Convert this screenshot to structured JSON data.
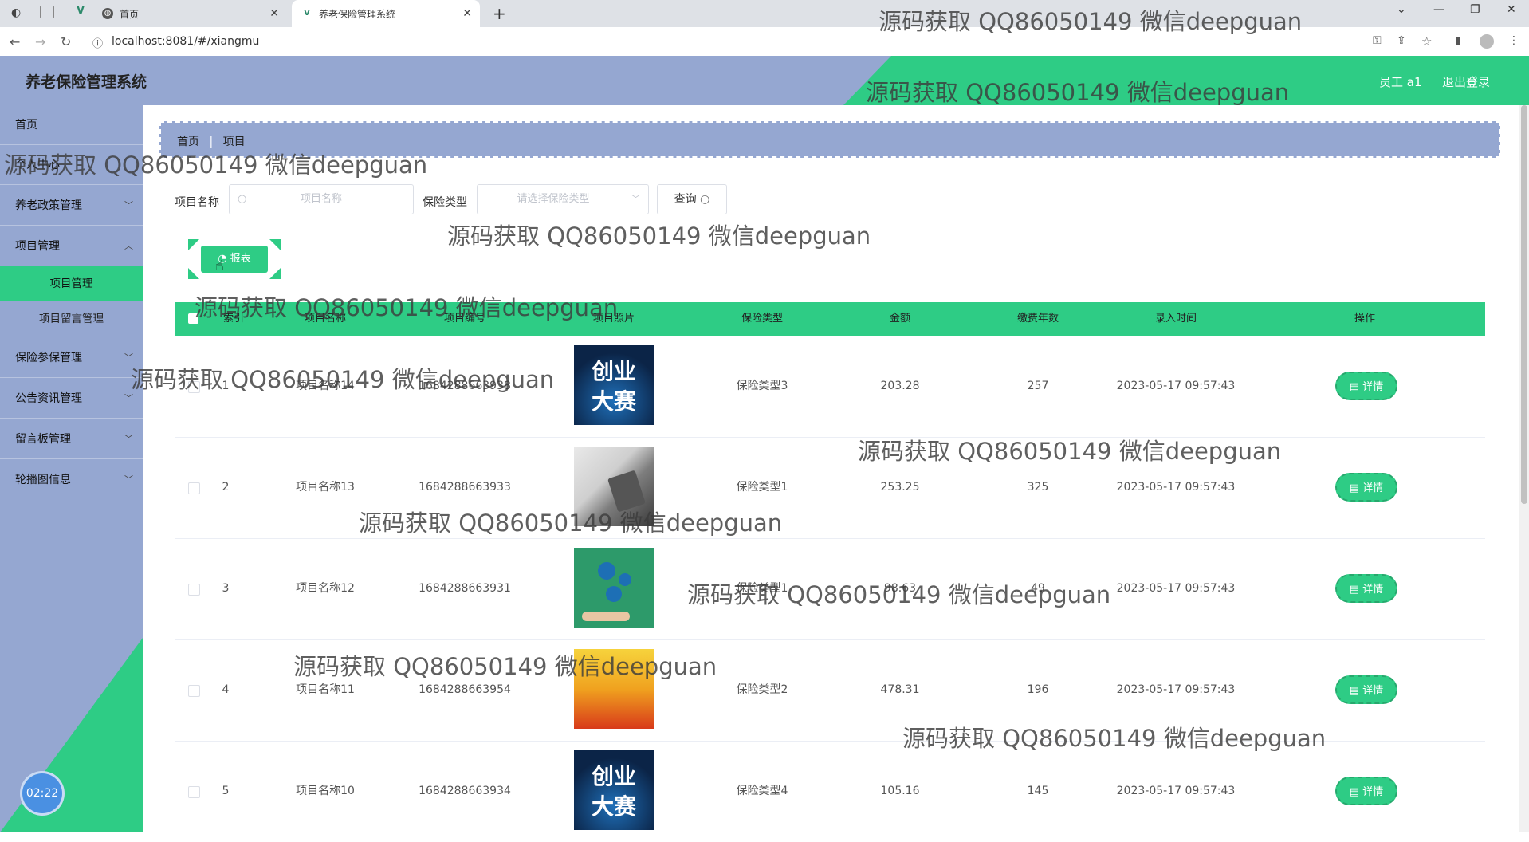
{
  "browser": {
    "tabs": [
      {
        "label": "首页"
      },
      {
        "label": "养老保险管理系统"
      }
    ],
    "url": "localhost:8081/#/xiangmu"
  },
  "app": {
    "title": "养老保险管理系统",
    "user_label": "员工 a1",
    "logout_label": "退出登录"
  },
  "sidebar": {
    "items": [
      {
        "label": "首页"
      },
      {
        "label": "个人中心"
      },
      {
        "label": "养老政策管理"
      },
      {
        "label": "项目管理"
      },
      {
        "label": "保险参保管理"
      },
      {
        "label": "公告资讯管理"
      },
      {
        "label": "留言板管理"
      },
      {
        "label": "轮播图信息"
      }
    ],
    "subitems": [
      {
        "label": "项目管理"
      },
      {
        "label": "项目留言管理"
      }
    ],
    "clock": "02:22"
  },
  "breadcrumb": {
    "home": "首页",
    "current": "项目"
  },
  "search": {
    "name_label": "项目名称",
    "name_placeholder": "项目名称",
    "type_label": "保险类型",
    "type_placeholder": "请选择保险类型",
    "query_label": "查询"
  },
  "report_label": "报表",
  "table": {
    "headers": [
      "索引",
      "项目名称",
      "项目编号",
      "项目照片",
      "保险类型",
      "金额",
      "缴费年数",
      "录入时间",
      "操作"
    ],
    "rows": [
      {
        "index": "1",
        "name": "项目名称14",
        "code": "1684288663938",
        "type": "保险类型3",
        "amount": "203.28",
        "years": "257",
        "time": "2023-05-17 09:57:43",
        "photo": "创业大赛"
      },
      {
        "index": "2",
        "name": "项目名称13",
        "code": "1684288663933",
        "type": "保险类型1",
        "amount": "253.25",
        "years": "325",
        "time": "2023-05-17 09:57:43",
        "photo": "calculator"
      },
      {
        "index": "3",
        "name": "项目名称12",
        "code": "1684288663931",
        "type": "保险类型1",
        "amount": "98.63",
        "years": "49",
        "time": "2023-05-17 09:57:43",
        "photo": "gears"
      },
      {
        "index": "4",
        "name": "项目名称11",
        "code": "1684288663954",
        "type": "保险类型2",
        "amount": "478.31",
        "years": "196",
        "time": "2023-05-17 09:57:43",
        "photo": "poster"
      },
      {
        "index": "5",
        "name": "项目名称10",
        "code": "1684288663934",
        "type": "保险类型4",
        "amount": "105.16",
        "years": "145",
        "time": "2023-05-17 09:57:43",
        "photo": "创业大赛"
      }
    ],
    "detail_label": "详情"
  },
  "photo_text": {
    "line1": "创业",
    "line2": "大赛"
  },
  "watermark": "源码获取 QQ86050149 微信deepguan",
  "colors": {
    "primary_green": "#2ecc85",
    "header_blue": "#95a7d1"
  }
}
